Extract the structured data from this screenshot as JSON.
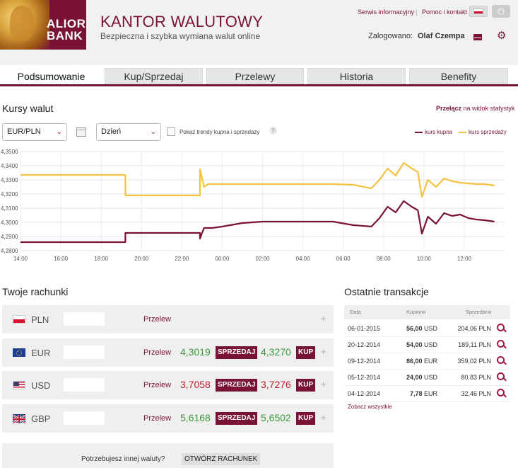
{
  "header": {
    "brand_line1": "ALIOR",
    "brand_line2": "BANK",
    "title": "KANTOR WALUTOWY",
    "subtitle": "Bezpieczna i szybka wymiana walut online",
    "links": [
      "Serwis informacyjny",
      "Pomoc i kontakt"
    ],
    "link_sep": "|",
    "login_label": "Zalogowano:",
    "login_name": "Olaf Czempa",
    "brand_color": "#7a1236"
  },
  "tabs": [
    {
      "label": "Podsumowanie",
      "active": true
    },
    {
      "label": "Kup/Sprzedaj",
      "active": false
    },
    {
      "label": "Przelewy",
      "active": false
    },
    {
      "label": "Historia",
      "active": false
    },
    {
      "label": "Benefity",
      "active": false
    }
  ],
  "rates": {
    "section_title": "Kursy walut",
    "switch_bold": "Przełącz",
    "switch_rest": " na widok statystyk",
    "pair_select": "EUR/PLN",
    "period_select": "Dzień",
    "trend_checkbox_label": "Pokaż trendy kupna i sprzedaży",
    "help": "?",
    "legend_buy": "kurs kupna",
    "legend_sell": "kurs sprzedaży",
    "buy_color": "#7a1236",
    "sell_color": "#f5c242"
  },
  "chart_data": {
    "type": "line",
    "x_ticks": [
      "14:00",
      "16:00",
      "18:00",
      "20:00",
      "22:00",
      "00:00",
      "02:00",
      "04:00",
      "06:00",
      "08:00",
      "10:00",
      "12:00"
    ],
    "y_ticks": [
      "4,3500",
      "4,3400",
      "4,3300",
      "4,3200",
      "4,3100",
      "4,3000",
      "4,2900",
      "4,2800"
    ],
    "ylim": [
      4.28,
      4.35
    ],
    "grid": true,
    "series": [
      {
        "name": "kurs sprzedaży",
        "color": "#f5c242",
        "x": [
          14.0,
          19.2,
          19.2,
          22.9,
          22.9,
          23.1,
          23.3,
          24.0,
          26.0,
          28.0,
          29.5,
          30.5,
          31.4,
          31.8,
          32.2,
          32.6,
          33.0,
          33.4,
          33.7,
          33.9,
          34.2,
          34.6,
          35.0,
          35.4,
          35.8,
          36.2,
          36.6,
          37.0,
          37.5
        ],
        "y": [
          4.3335,
          4.3335,
          4.319,
          4.319,
          4.3375,
          4.325,
          4.327,
          4.327,
          4.327,
          4.327,
          4.327,
          4.3265,
          4.324,
          4.33,
          4.338,
          4.333,
          4.342,
          4.338,
          4.3355,
          4.318,
          4.33,
          4.325,
          4.331,
          4.329,
          4.328,
          4.3275,
          4.327,
          4.327,
          4.326
        ]
      },
      {
        "name": "kurs kupna",
        "color": "#7a1236",
        "x": [
          14.0,
          19.2,
          19.2,
          22.9,
          22.9,
          23.1,
          23.5,
          24.0,
          25.0,
          26.0,
          28.0,
          29.5,
          30.5,
          31.4,
          31.8,
          32.2,
          32.6,
          33.0,
          33.4,
          33.7,
          33.9,
          34.2,
          34.6,
          35.0,
          35.4,
          35.8,
          36.2,
          36.6,
          37.0,
          37.5
        ],
        "y": [
          4.286,
          4.286,
          4.2925,
          4.2925,
          4.2885,
          4.296,
          4.296,
          4.297,
          4.2995,
          4.3005,
          4.3005,
          4.3005,
          4.298,
          4.297,
          4.303,
          4.311,
          4.307,
          4.315,
          4.311,
          4.3085,
          4.292,
          4.304,
          4.299,
          4.3065,
          4.3045,
          4.3055,
          4.303,
          4.302,
          4.3015,
          4.3005
        ]
      }
    ]
  },
  "accounts": {
    "section_title": "Twoje rachunki",
    "przelew_label": "Przelew",
    "sell_label": "SPRZEDAJ",
    "buy_label": "KUP",
    "plus": "+",
    "items": [
      {
        "code": "PLN",
        "flag": "pl-flag",
        "sell_rate": "",
        "buy_rate": "",
        "has_rates": false
      },
      {
        "code": "EUR",
        "flag": "eu-flag",
        "sell_rate": "4,3019",
        "buy_rate": "4,3270",
        "has_rates": true,
        "trend": "green"
      },
      {
        "code": "USD",
        "flag": "us-flag",
        "sell_rate": "3,7058",
        "buy_rate": "3,7276",
        "has_rates": true,
        "trend": "red"
      },
      {
        "code": "GBP",
        "flag": "gb-flag",
        "sell_rate": "5,6168",
        "buy_rate": "5,6502",
        "has_rates": true,
        "trend": "green"
      }
    ],
    "open_question": "Potrzebujesz innej waluty?",
    "open_button": "OTWÓRZ RACHUNEK"
  },
  "transactions": {
    "section_title": "Ostatnie transakcje",
    "headers": [
      "Data",
      "Kupiono",
      "Sprzedano"
    ],
    "rows": [
      {
        "date": "06-01-2015",
        "bought": "56,00",
        "bought_cur": "USD",
        "sold": "204,06 PLN"
      },
      {
        "date": "20-12-2014",
        "bought": "54,00",
        "bought_cur": "USD",
        "sold": "189,11 PLN"
      },
      {
        "date": "09-12-2014",
        "bought": "86,00",
        "bought_cur": "EUR",
        "sold": "359,02 PLN"
      },
      {
        "date": "05-12-2014",
        "bought": "24,00",
        "bought_cur": "USD",
        "sold": "80,83 PLN"
      },
      {
        "date": "04-12-2014",
        "bought": "7,78",
        "bought_cur": "EUR",
        "sold": "32,46 PLN"
      }
    ],
    "see_all": "Zobacz wszystkie"
  }
}
